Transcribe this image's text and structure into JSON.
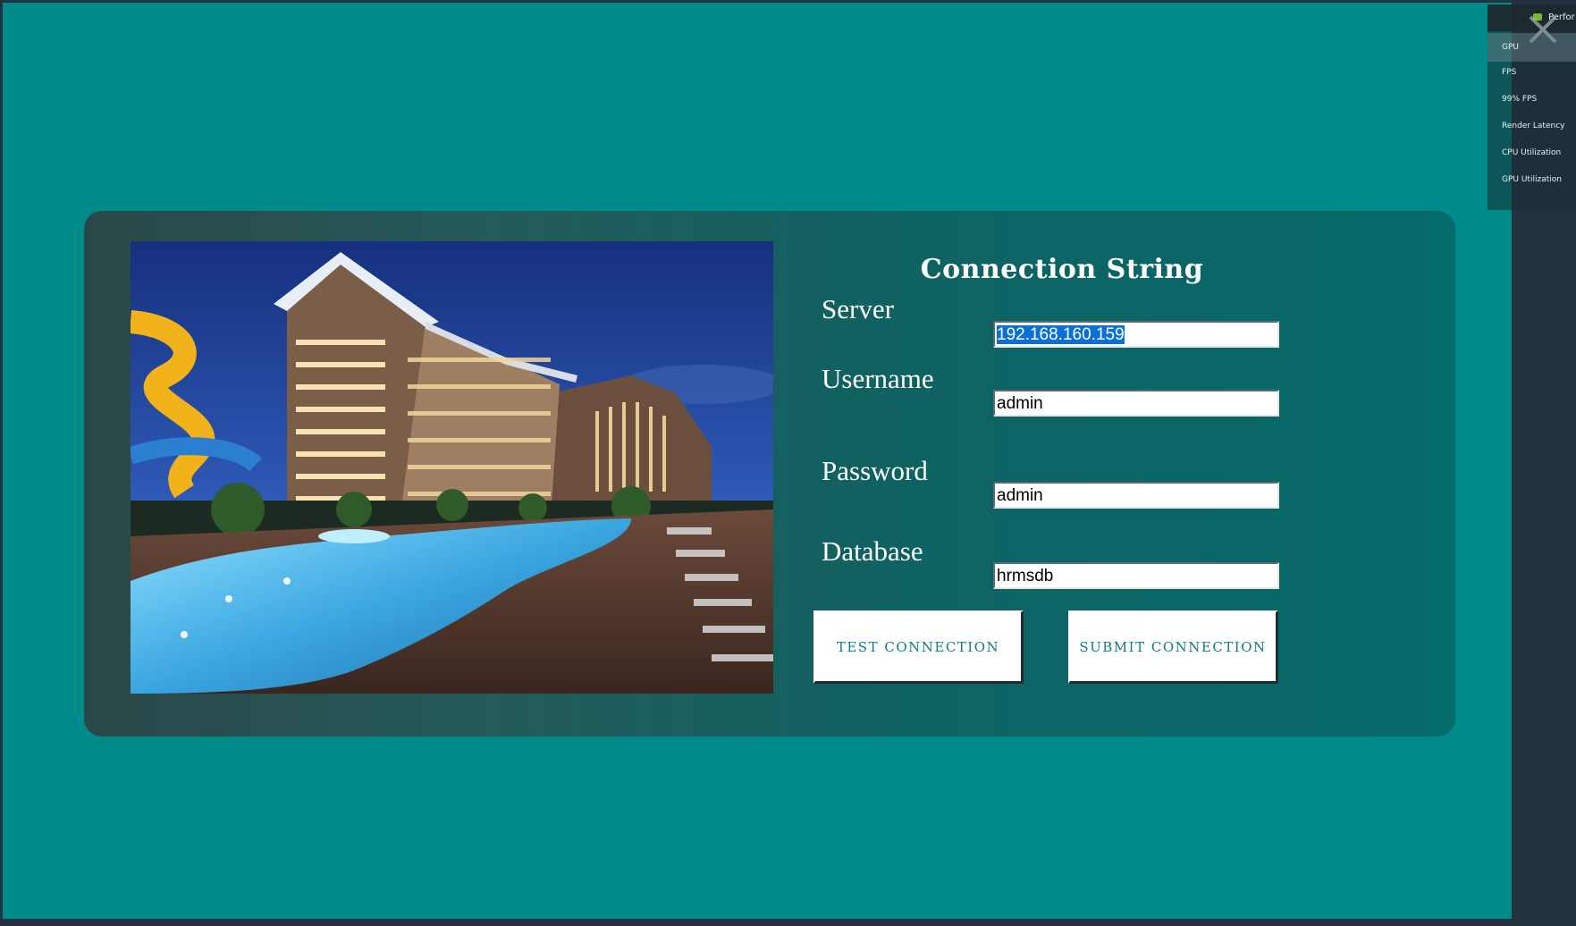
{
  "form": {
    "title": "Connection String",
    "server_label": "Server",
    "server_value": "192.168.160.159",
    "username_label": "Username",
    "username_value": "admin",
    "password_label": "Password",
    "password_value": "admin",
    "database_label": "Database",
    "database_value": "hrmsdb",
    "test_button": "TEST CONNECTION",
    "submit_button": "SUBMIT CONNECTION"
  },
  "overlay": {
    "title": "Perfor",
    "items": [
      "GPU",
      "FPS",
      "99% FPS",
      "Render Latency",
      "CPU Utilization",
      "GPU Utilization"
    ],
    "active_item": "GPU"
  },
  "colors": {
    "background": "#008a89",
    "card": "#0f6262",
    "button_text": "#0d7f80",
    "selection": "#0a6fd6"
  },
  "icons": {
    "overlay_logo": "nvidia-icon",
    "overlay_close": "close-icon"
  }
}
